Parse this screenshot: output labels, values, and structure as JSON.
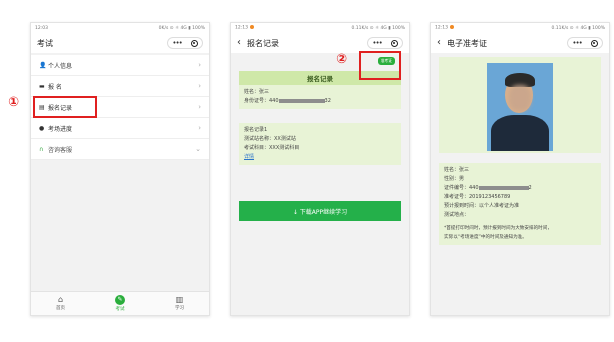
{
  "phone1": {
    "status": {
      "time": "12:03",
      "indicators": "0K/s ⊙ ☼ 4G ▮ 100%"
    },
    "nav": {
      "title": "考试"
    },
    "menu": [
      {
        "icon": "person-icon",
        "glyph": "👤",
        "label": "个人信息"
      },
      {
        "icon": "id-card-icon",
        "glyph": "▬",
        "label": "报 名"
      },
      {
        "icon": "record-icon",
        "glyph": "▤",
        "label": "报名记录"
      },
      {
        "icon": "progress-icon",
        "glyph": "●",
        "label": "考场进度"
      },
      {
        "icon": "headset-icon",
        "glyph": "∩",
        "label": "咨询客服"
      }
    ],
    "marker": "①",
    "tabs": [
      {
        "icon": "home-icon",
        "glyph": "⌂",
        "label": "首页"
      },
      {
        "icon": "exam-icon",
        "glyph": "✎",
        "label": "考试"
      },
      {
        "icon": "book-icon",
        "glyph": "▥",
        "label": "学习"
      }
    ]
  },
  "phone2": {
    "status": {
      "time": "12:13",
      "indicators": "0.11K/s ⊙ ☼ 4G ▮ 100%"
    },
    "nav": {
      "back": "‹",
      "title": "报名记录"
    },
    "marker": "②",
    "badge": "准考证",
    "card1": {
      "head": "报名记录",
      "name": "姓名：张三",
      "id_prefix": "身份证号：440",
      "id_suffix": "32"
    },
    "card2": {
      "line1": "报名记录1",
      "line2": "测试站名称：XX测试站",
      "line3": "考试科目：XXX测试科目",
      "link": "详情"
    },
    "download": "↓  下载APP继续学习"
  },
  "phone3": {
    "status": {
      "time": "12:13",
      "indicators": "0.11K/s ⊙ ☼ 4G ▮ 100%"
    },
    "nav": {
      "back": "‹",
      "title": "电子准考证"
    },
    "info": {
      "name": "姓名：张三",
      "gender": "性别：男",
      "id_prefix": "证件编号：440",
      "id_suffix": "2",
      "ticket": "准考证号：2019123456789",
      "time": "预计报到时间：以个人准考证为准",
      "place": "测试地点："
    },
    "note1": "*首提打印时间时，预计报到时间为大致安排的时间，",
    "note2": "实际以“考场进度”中的时间及通知为准。"
  }
}
